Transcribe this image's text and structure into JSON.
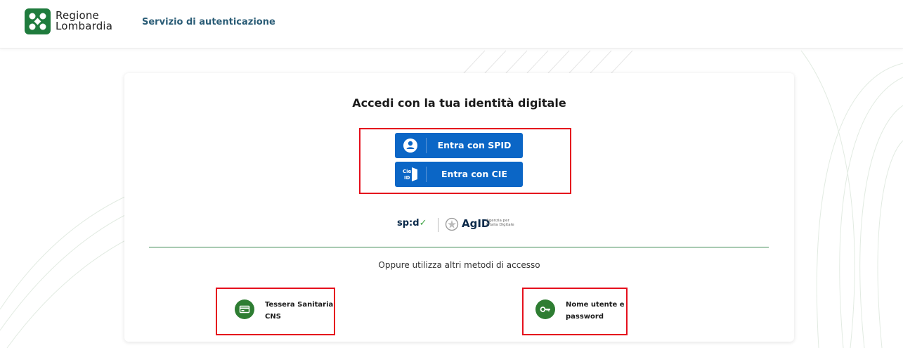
{
  "header": {
    "logo_line1": "Regione",
    "logo_line2": "Lombardia",
    "service_title": "Servizio di autenticazione"
  },
  "main": {
    "title": "Accedi con la tua identità digitale",
    "spid_button": "Entra con SPID",
    "cie_button": "Entra con CIE",
    "cie_icon_text_1": "Cie",
    "cie_icon_text_2": "ID",
    "spid_logo": "sp:d",
    "agid_logo": "AgID",
    "agid_subtitle_1": "Agenzia per",
    "agid_subtitle_2": "l'Italia Digitale",
    "alternative_text": "Oppure utilizza altri metodi di accesso",
    "cns_line1": "Tessera Sanitaria",
    "cns_line2": "CNS",
    "userpass_line1": "Nome utente e",
    "userpass_line2": "password"
  },
  "colors": {
    "brand_green": "#1f7b3d",
    "button_blue": "#0b66c6",
    "highlight_red": "#e5101d",
    "icon_green": "#2e7d32"
  }
}
